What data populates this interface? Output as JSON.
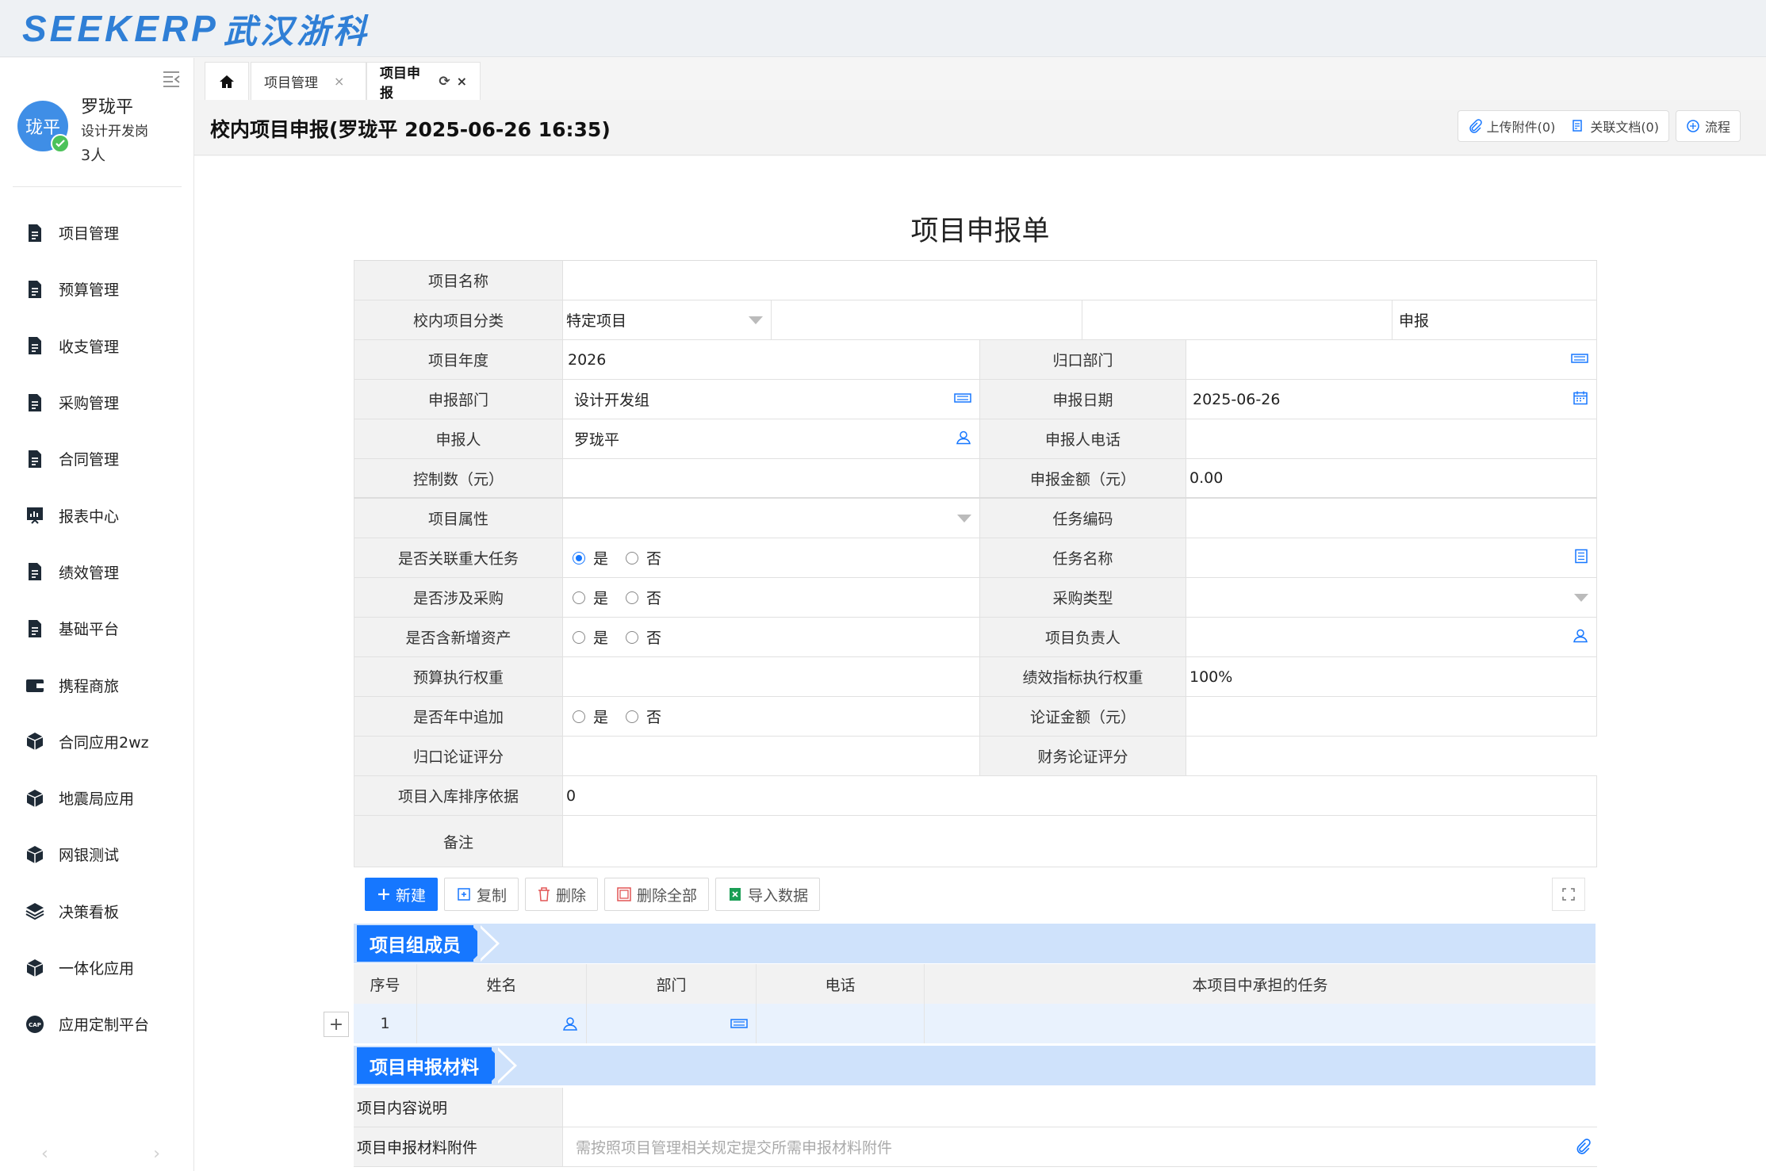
{
  "app": {
    "logo_latin": "SEEKERP",
    "logo_cn": "武汉浙科"
  },
  "user": {
    "avatar_text": "珑平",
    "name": "罗珑平",
    "role": "设计开发岗",
    "count": "3人"
  },
  "menu": [
    {
      "label": "项目管理",
      "icon": "document-icon"
    },
    {
      "label": "预算管理",
      "icon": "document-icon"
    },
    {
      "label": "收支管理",
      "icon": "document-icon"
    },
    {
      "label": "采购管理",
      "icon": "document-icon"
    },
    {
      "label": "合同管理",
      "icon": "document-icon"
    },
    {
      "label": "报表中心",
      "icon": "report-chart-icon"
    },
    {
      "label": "绩效管理",
      "icon": "document-icon"
    },
    {
      "label": "基础平台",
      "icon": "document-icon"
    },
    {
      "label": "携程商旅",
      "icon": "wallet-icon"
    },
    {
      "label": "合同应用2wz",
      "icon": "cube-icon"
    },
    {
      "label": "地震局应用",
      "icon": "cube-icon"
    },
    {
      "label": "网银测试",
      "icon": "cube-icon"
    },
    {
      "label": "决策看板",
      "icon": "layers-icon"
    },
    {
      "label": "一体化应用",
      "icon": "cube-icon"
    },
    {
      "label": "应用定制平台",
      "icon": "cap-icon"
    }
  ],
  "tabs": {
    "t1": "项目管理",
    "t2": "项目申报",
    "close": "×"
  },
  "titlebar": {
    "title": "校内项目申报(罗珑平 2025-06-26 16:35)",
    "upload": "上传附件(0)",
    "related": "关联文档(0)",
    "flow": "流程"
  },
  "form": {
    "title": "项目申报单",
    "project_name_label": "项目名称",
    "category_label": "校内项目分类",
    "category_value": "特定项目",
    "apply_text": "申报",
    "year_label": "项目年度",
    "year_value": "2026",
    "dept_owner_label": "归口部门",
    "apply_dept_label": "申报部门",
    "apply_dept_value": "设计开发组",
    "apply_date_label": "申报日期",
    "apply_date_value": "2025-06-26",
    "applicant_label": "申报人",
    "applicant_value": "罗珑平",
    "applicant_phone_label": "申报人电话",
    "control_label": "控制数（元）",
    "amount_label": "申报金额（元）",
    "amount_value": "0.00",
    "attribute_label": "项目属性",
    "task_code_label": "任务编码",
    "major_task_label": "是否关联重大任务",
    "task_name_label": "任务名称",
    "purchase_label": "是否涉及采购",
    "purchase_type_label": "采购类型",
    "new_asset_label": "是否含新增资产",
    "leader_label": "项目负责人",
    "budget_weight_label": "预算执行权重",
    "perf_weight_label": "绩效指标执行权重",
    "perf_weight_value": "100%",
    "midyear_label": "是否年中追加",
    "proof_amount_label": "论证金额（元）",
    "owner_score_label": "归口论证评分",
    "finance_score_label": "财务论证评分",
    "sort_label": "项目入库排序依据",
    "sort_value": "0",
    "remark_label": "备注",
    "yes": "是",
    "no": "否"
  },
  "toolbar": {
    "new": "新建",
    "copy": "复制",
    "delete": "删除",
    "delete_all": "删除全部",
    "import": "导入数据"
  },
  "members": {
    "section": "项目组成员",
    "columns": [
      "序号",
      "姓名",
      "部门",
      "电话",
      "本项目中承担的任务"
    ],
    "rows": [
      {
        "index": "1"
      }
    ],
    "add": "+"
  },
  "materials": {
    "section": "项目申报材料",
    "content_label": "项目内容说明",
    "attach_label": "项目申报材料附件",
    "attach_placeholder": "需按照项目管理相关规定提交所需申报材料附件"
  },
  "colors": {
    "primary": "#1677ff",
    "section_bg": "#cfe2fb",
    "label_bg": "#f2f2f2",
    "avatar": "#3f8ee6"
  }
}
